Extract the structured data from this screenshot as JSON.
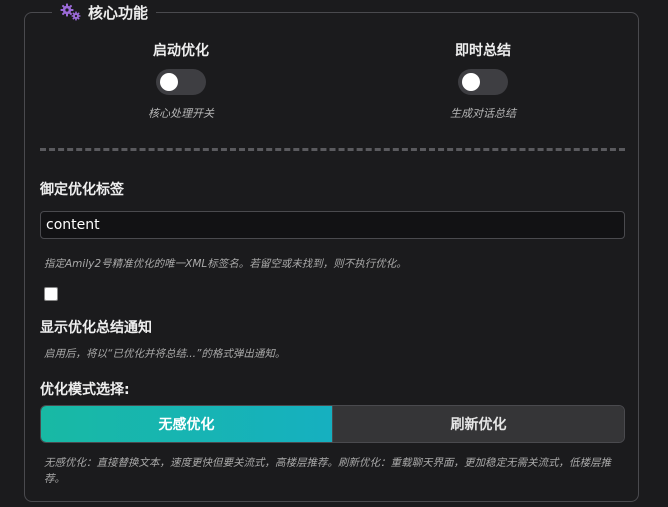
{
  "section": {
    "title": "核心功能",
    "icon": "gears-icon"
  },
  "toggles": [
    {
      "label": "启动优化",
      "desc": "核心处理开关",
      "on": false
    },
    {
      "label": "即时总结",
      "desc": "生成对话总结",
      "on": false
    }
  ],
  "tag_field": {
    "label": "御定优化标签",
    "value": "content",
    "hint": "指定Amily2号精准优化的唯一XML标签名。若留空或未找到，则不执行优化。"
  },
  "notify": {
    "checked": false,
    "label": "显示优化总结通知",
    "hint": "启用后，将以“已优化并将总结...”的格式弹出通知。"
  },
  "mode": {
    "label": "优化模式选择:",
    "options": [
      "无感优化",
      "刷新优化"
    ],
    "selected": "无感优化",
    "hint": "无感优化：直接替换文本，速度更快但要关流式，高楼层推荐。刷新优化：重载聊天界面，更加稳定无需关流式，低楼层推荐。"
  },
  "colors": {
    "accent_start": "#18b9a4",
    "accent_end": "#16b0c0",
    "background": "#1b1b1d"
  }
}
